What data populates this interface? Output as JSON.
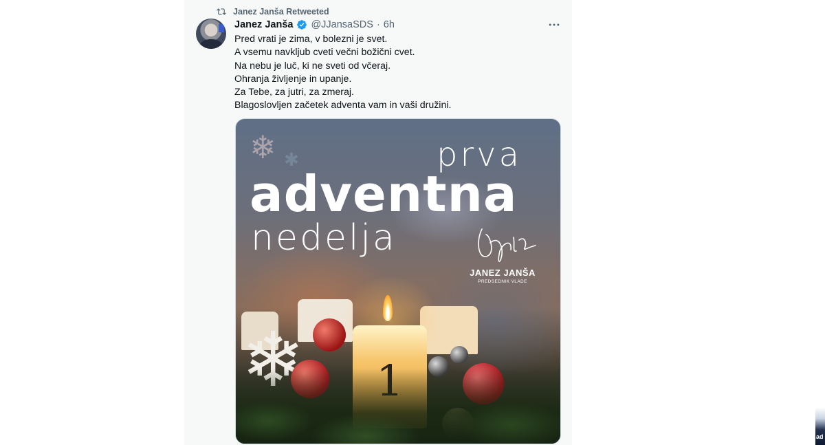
{
  "retweet": {
    "label": "Janez Janša Retweeted",
    "icon": "retweet-icon"
  },
  "tweet": {
    "author_name": "Janez Janša",
    "verified_icon": "verified-badge-icon",
    "handle": "@JJansaSDS",
    "separator": "·",
    "time": "6h",
    "more_icon": "more-dots-icon",
    "text_lines": [
      "Pred vrati je zima, v bolezni je svet.",
      "A vsemu navkljub cveti večni božični cvet.",
      "Na nebu je luč, ki ne sveti od včeraj.",
      "Ohranja življenje in upanje.",
      "Za Tebe, za jutri, za zmeraj.",
      "Blagoslovljen začetek adventa vam in vaši družini."
    ]
  },
  "media": {
    "line1": "prva",
    "line2": "adventna",
    "line3": "nedelja",
    "signature_name": "JANEZ JANŠA",
    "signature_role": "PREDSEDNIK VLADE",
    "candle_number": "1"
  },
  "edge": {
    "text": "ad"
  },
  "colors": {
    "timeline_bg": "#f7f9f9",
    "verified_blue": "#1d9bf0",
    "secondary_text": "#536471",
    "primary_text": "#0f1419"
  }
}
